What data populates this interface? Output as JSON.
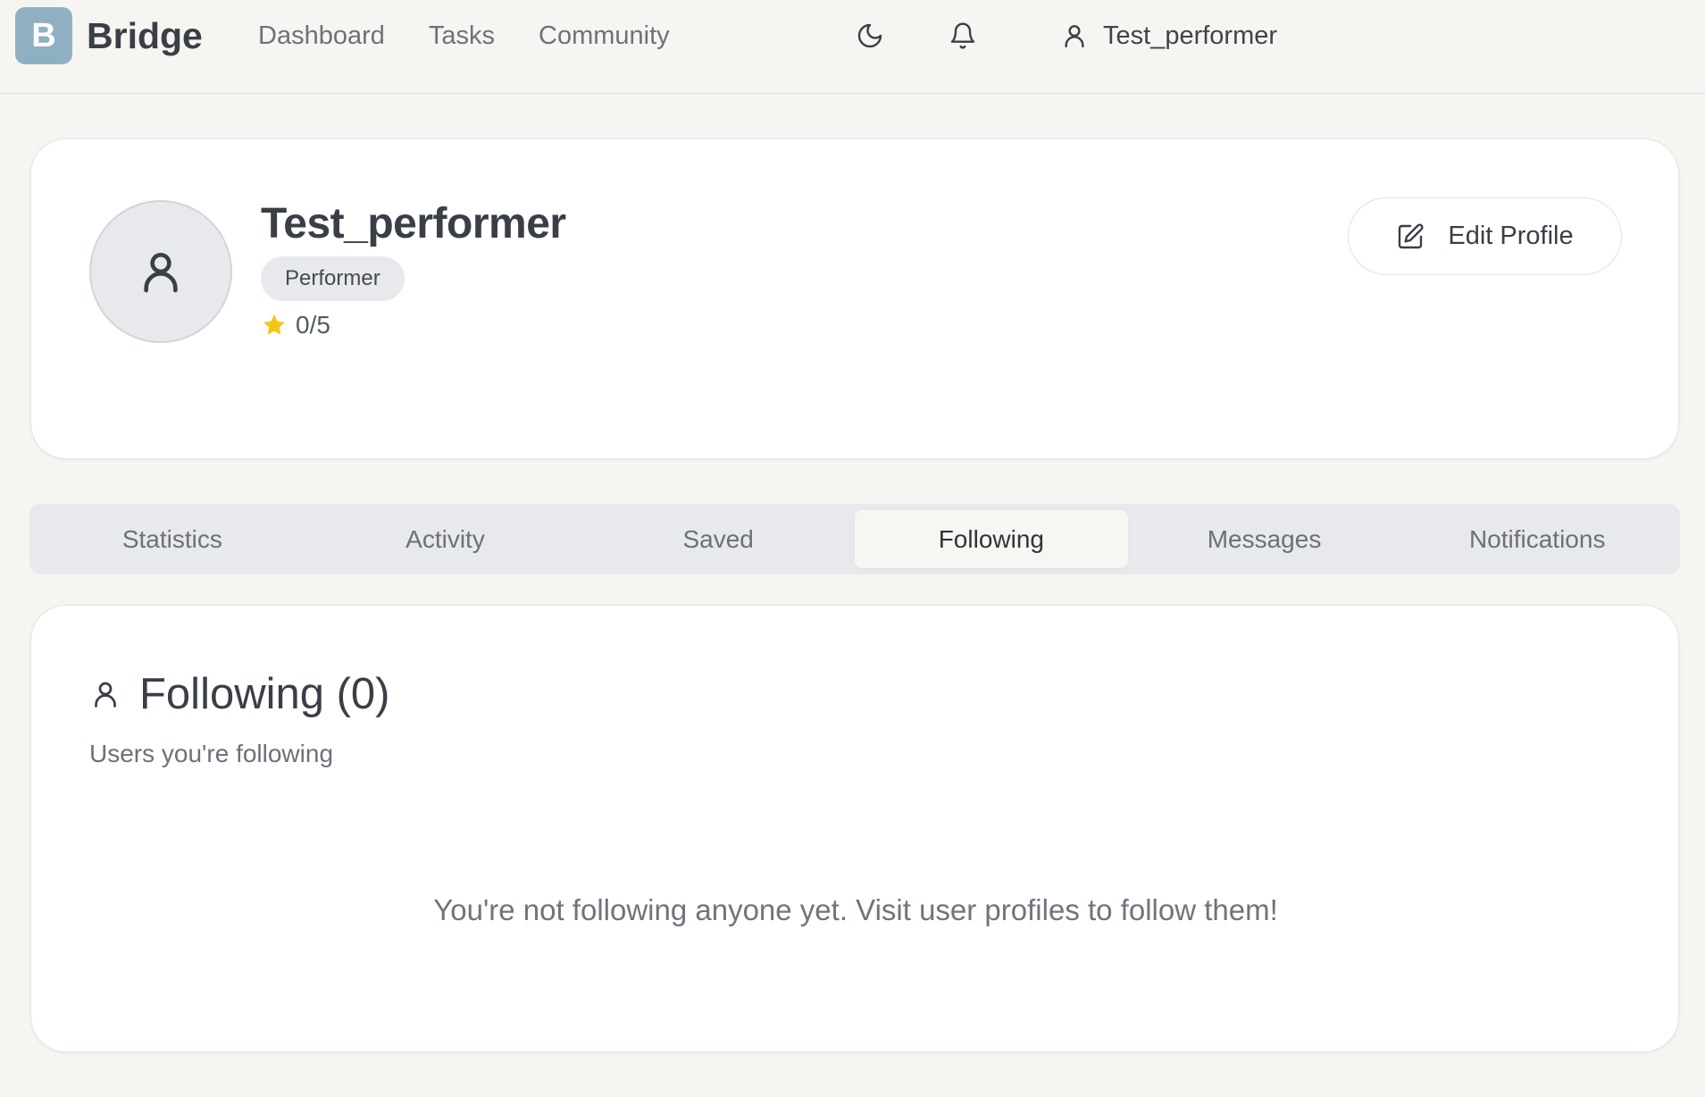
{
  "app": {
    "logo_letter": "B",
    "name": "Bridge"
  },
  "nav": {
    "items": [
      "Dashboard",
      "Tasks",
      "Community"
    ]
  },
  "header": {
    "theme_icon": "moon-icon",
    "notifications_icon": "bell-icon",
    "user_icon": "user-icon",
    "username": "Test_performer"
  },
  "profile": {
    "name": "Test_performer",
    "role": "Performer",
    "rating": "0/5",
    "rating_icon": "star-icon",
    "edit_label": "Edit Profile"
  },
  "tabs": {
    "items": [
      "Statistics",
      "Activity",
      "Saved",
      "Following",
      "Messages",
      "Notifications"
    ],
    "active": "Following"
  },
  "following": {
    "title": "Following (0)",
    "subtitle": "Users you're following",
    "empty_message": "You're not following anyone yet. Visit user profiles to follow them!"
  },
  "colors": {
    "background": "#f6f5f2",
    "logo": "#8fb0c3",
    "star": "#f5c518",
    "card": "#ffffff"
  }
}
